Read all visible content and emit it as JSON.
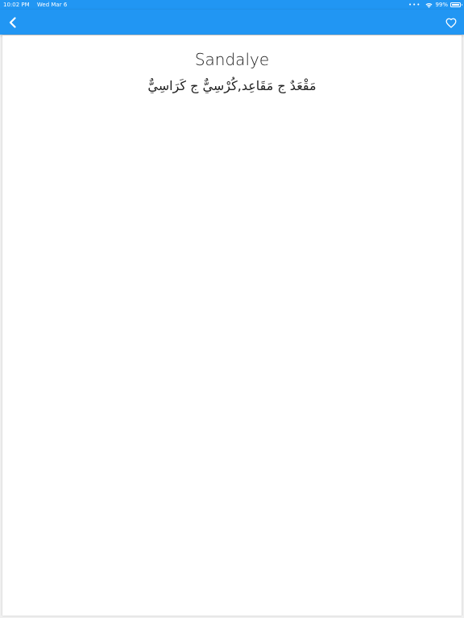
{
  "status_bar": {
    "time": "10:02 PM",
    "date": "Wed Mar 6",
    "dots": "•••",
    "wifi_icon": "wifi-icon",
    "battery_percent": "99%",
    "battery_icon": "battery-icon",
    "battery_level": 0.99
  },
  "app_bar": {
    "back_icon": "chevron-left-icon",
    "favorite_icon": "heart-outline-icon",
    "color": "#2196f3"
  },
  "entry": {
    "word": "Sandalye",
    "translation": "مَقْعَدٌ ج مَقَاعِد,كُرْسِيٌّ ج كَرَاسِيٌّ"
  }
}
